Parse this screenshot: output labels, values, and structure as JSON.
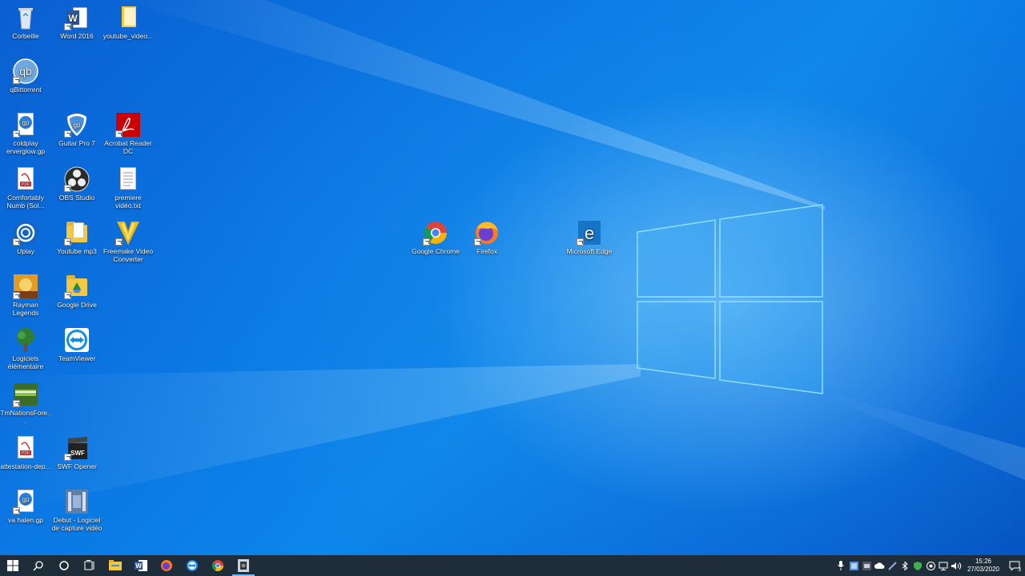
{
  "desktop": {
    "icons": {
      "corbeille": "Corbeille",
      "word": "Word 2016",
      "youtube_video": "youtube_video...",
      "qbittorrent": "qBittorrent",
      "coldplay": "coldplay\nerverglow.gp",
      "guitarpro": "Guitar Pro 7",
      "acrobat": "Acrobat Reader DC",
      "comfortably": "Comfortably Numb (Sol...",
      "obs": "OBS Studio",
      "premiere": "premiere vidéo.txt",
      "uplay": "Uplay",
      "youtube_mp3": "Youtube mp3",
      "freemake": "Freemake Video Converter",
      "rayman": "Rayman Legends",
      "gdrive": "Google Drive",
      "logiciels": "Logiciels élémentaire",
      "teamviewer": "TeamViewer",
      "tmnations": "TmNationsFore...",
      "attestation": "attestation-dep...",
      "swf": "SWF Opener",
      "vahalen": "va halen.gp",
      "debut": "Debut - Logiciel de capture vidéo",
      "chrome": "Google Chrome",
      "firefox": "Firefox",
      "edge": "Microsoft Edge"
    }
  },
  "taskbar": {
    "clock_time": "15:26",
    "clock_date": "27/03/2020",
    "notification_count": "3"
  },
  "colors": {
    "taskbar_bg": "#1f2d3a",
    "accent": "#76b9ed"
  }
}
